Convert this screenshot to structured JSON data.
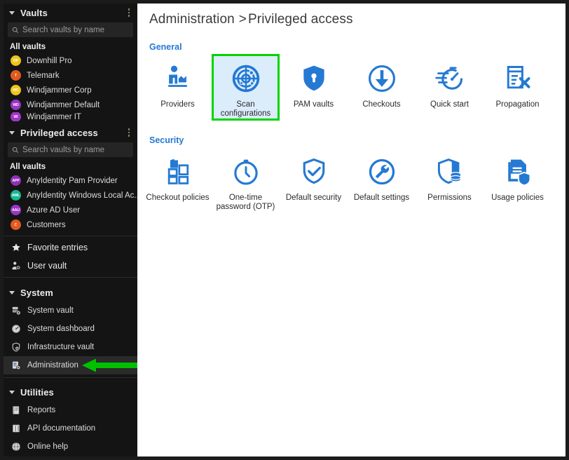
{
  "sidebar": {
    "sections": [
      {
        "id": "vaults",
        "title": "Vaults",
        "menu_icon": "kebab-menu-icon",
        "caret_icon": "caret-down-icon",
        "search": {
          "placeholder": "Search vaults by name",
          "value": "",
          "icon": "search-icon"
        },
        "group_label": "All vaults",
        "items": [
          {
            "label": "Downhill Pro",
            "initials": "DP",
            "color": "#f0c419"
          },
          {
            "label": "Telemark",
            "initials": "T",
            "color": "#e2591f"
          },
          {
            "label": "Windjammer Corp",
            "initials": "WC",
            "color": "#f0c419"
          },
          {
            "label": "Windjammer Default",
            "initials": "WD",
            "color": "#9a35c7"
          },
          {
            "label": "Windjammer IT",
            "initials": "WI",
            "color": "#a235c7"
          }
        ]
      },
      {
        "id": "privileged-access",
        "title": "Privileged access",
        "menu_icon": "kebab-menu-icon",
        "caret_icon": "caret-down-icon",
        "search": {
          "placeholder": "Search vaults by name",
          "value": "",
          "icon": "search-icon"
        },
        "group_label": "All vaults",
        "items": [
          {
            "label": "AnyIdentity Pam Provider",
            "initials": "APP",
            "color": "#8e2fb8"
          },
          {
            "label": "AnyIdentity Windows Local Ac...",
            "initials": "AWL",
            "color": "#17b890"
          },
          {
            "label": "Azure AD User",
            "initials": "AAU",
            "color": "#9a35c7"
          },
          {
            "label": "Customers",
            "initials": "C",
            "color": "#e2591f"
          }
        ]
      }
    ],
    "quick_links": [
      {
        "label": "Favorite entries",
        "icon": "star-icon"
      },
      {
        "label": "User vault",
        "icon": "user-vault-icon"
      }
    ],
    "system": {
      "title": "System",
      "caret_icon": "caret-down-icon",
      "items": [
        {
          "label": "System vault",
          "icon": "system-vault-icon",
          "selected": false
        },
        {
          "label": "System dashboard",
          "icon": "system-dashboard-icon",
          "selected": false
        },
        {
          "label": "Infrastructure vault",
          "icon": "infrastructure-vault-icon",
          "selected": false
        },
        {
          "label": "Administration",
          "icon": "administration-icon",
          "selected": true
        }
      ]
    },
    "utilities": {
      "title": "Utilities",
      "caret_icon": "caret-down-icon",
      "items": [
        {
          "label": "Reports",
          "icon": "reports-icon"
        },
        {
          "label": "API documentation",
          "icon": "api-documentation-icon"
        },
        {
          "label": "Online help",
          "icon": "online-help-icon"
        }
      ]
    },
    "annotation": {
      "name": "green-arrow-pointer",
      "color": "#00c000",
      "points_to": "Administration"
    }
  },
  "main": {
    "breadcrumb": {
      "root": "Administration",
      "separator": ">",
      "current": "Privileged access"
    },
    "accent_color": "#2479d3",
    "highlight_border_color": "#00d400",
    "highlight_background_color": "#dbecfb",
    "groups": [
      {
        "title": "General",
        "tiles": [
          {
            "label": "Providers",
            "icon": "providers-icon",
            "selected": false
          },
          {
            "label": "Scan configurations",
            "icon": "scan-configurations-icon",
            "selected": true
          },
          {
            "label": "PAM vaults",
            "icon": "pam-vaults-icon",
            "selected": false
          },
          {
            "label": "Checkouts",
            "icon": "checkouts-icon",
            "selected": false
          },
          {
            "label": "Quick start",
            "icon": "quick-start-icon",
            "selected": false
          },
          {
            "label": "Propagation",
            "icon": "propagation-icon",
            "selected": false
          }
        ]
      },
      {
        "title": "Security",
        "tiles": [
          {
            "label": "Checkout policies",
            "icon": "checkout-policies-icon",
            "selected": false
          },
          {
            "label": "One-time password (OTP)",
            "icon": "otp-icon",
            "selected": false
          },
          {
            "label": "Default security",
            "icon": "default-security-icon",
            "selected": false
          },
          {
            "label": "Default settings",
            "icon": "default-settings-icon",
            "selected": false
          },
          {
            "label": "Permissions",
            "icon": "permissions-icon",
            "selected": false
          },
          {
            "label": "Usage policies",
            "icon": "usage-policies-icon",
            "selected": false
          }
        ]
      }
    ]
  }
}
